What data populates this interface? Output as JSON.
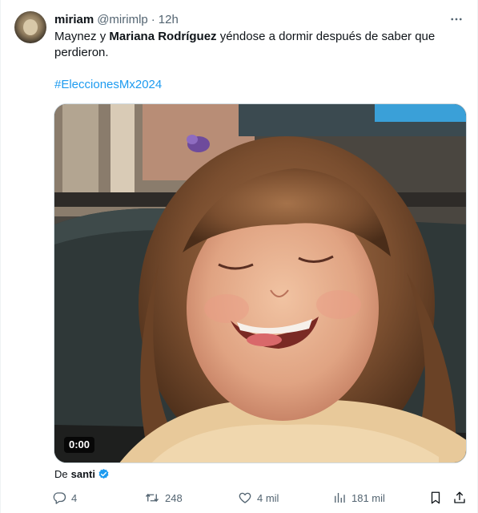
{
  "author": {
    "name": "miriam",
    "handle": "@mirimlp",
    "separator": "·",
    "time": "12h"
  },
  "post": {
    "text_before": "Maynez y ",
    "text_bold": "Mariana Rodríguez",
    "text_after": " yéndose a dormir después de saber que perdieron.",
    "hashtag": "#EleccionesMx2024"
  },
  "media": {
    "duration": "0:00"
  },
  "attribution": {
    "prefix": "De",
    "source": "santi"
  },
  "actions": {
    "replies": "4",
    "reposts": "248",
    "likes": "4 mil",
    "views": "181 mil"
  },
  "colors": {
    "accent": "#1d9bf0",
    "secondary_text": "#536471"
  },
  "icons": [
    "more-icon",
    "verified-icon",
    "reply-icon",
    "repost-icon",
    "like-icon",
    "views-icon",
    "bookmark-icon",
    "share-icon"
  ]
}
